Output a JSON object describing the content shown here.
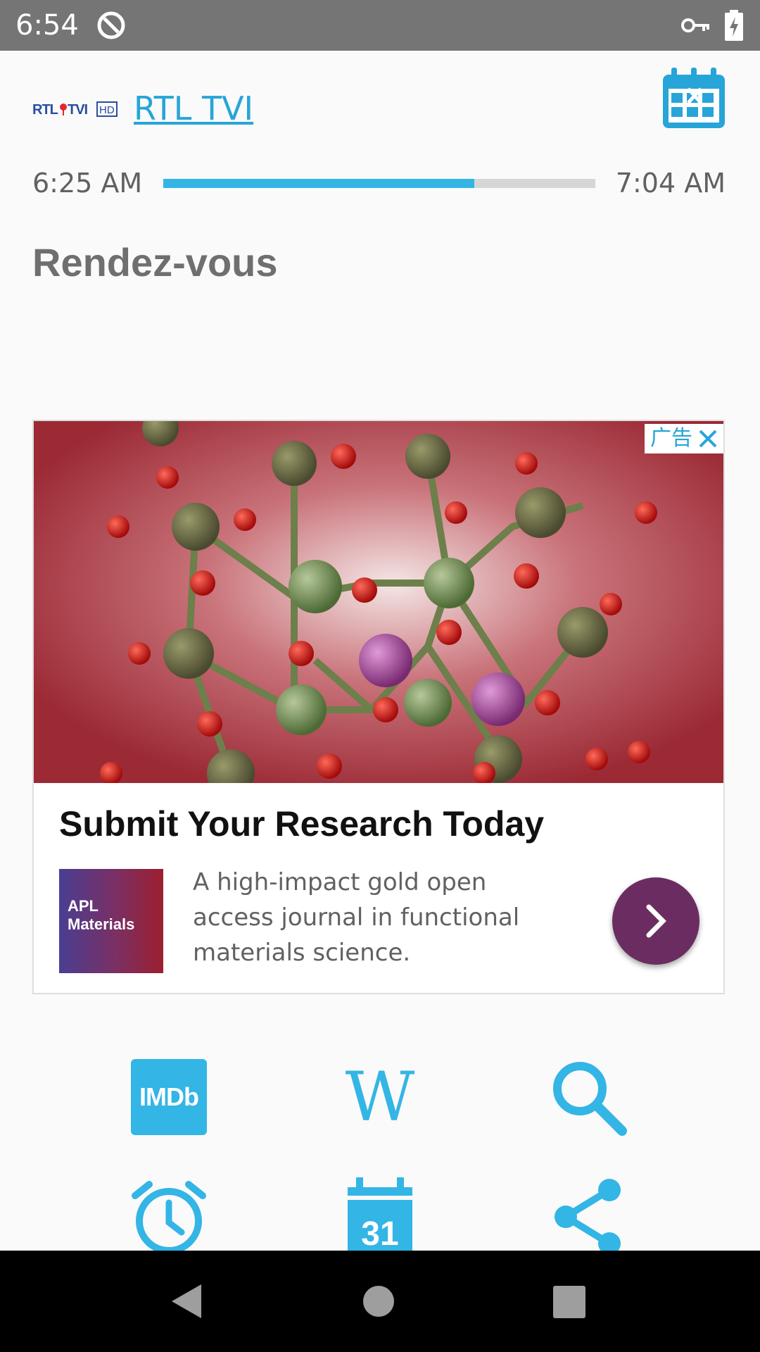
{
  "status_bar": {
    "time": "6:54",
    "icons": [
      "no-disturb-icon",
      "vpn-key-icon",
      "battery-charging-icon"
    ]
  },
  "header": {
    "channel_logo": "RTL TVI HD",
    "channel_name": "RTL TVI",
    "calendar_icon": "calendar-cancel-icon"
  },
  "program": {
    "start_time": "6:25 AM",
    "end_time": "7:04 AM",
    "progress": 0.72,
    "title": "Rendez-vous"
  },
  "ad": {
    "choices_label": "广告",
    "headline": "Submit Your Research Today",
    "logo_line1": "APL",
    "logo_line2": "Materials",
    "body": "A high-impact gold open access journal in functional materials science.",
    "cta_icon": "chevron-right-icon",
    "image": "molecular-structure-illustration"
  },
  "actions": [
    {
      "name": "imdb",
      "label": "IMDb",
      "icon": "imdb-icon"
    },
    {
      "name": "wikipedia",
      "label": "W",
      "icon": "wikipedia-icon"
    },
    {
      "name": "search",
      "icon": "search-icon"
    },
    {
      "name": "alarm",
      "icon": "alarm-clock-icon"
    },
    {
      "name": "calendar",
      "label": "31",
      "icon": "calendar-icon"
    },
    {
      "name": "share",
      "icon": "share-icon"
    }
  ],
  "colors": {
    "accent": "#33b5e5",
    "status_bar": "#757575",
    "ad_cta": "#6b2d61"
  }
}
